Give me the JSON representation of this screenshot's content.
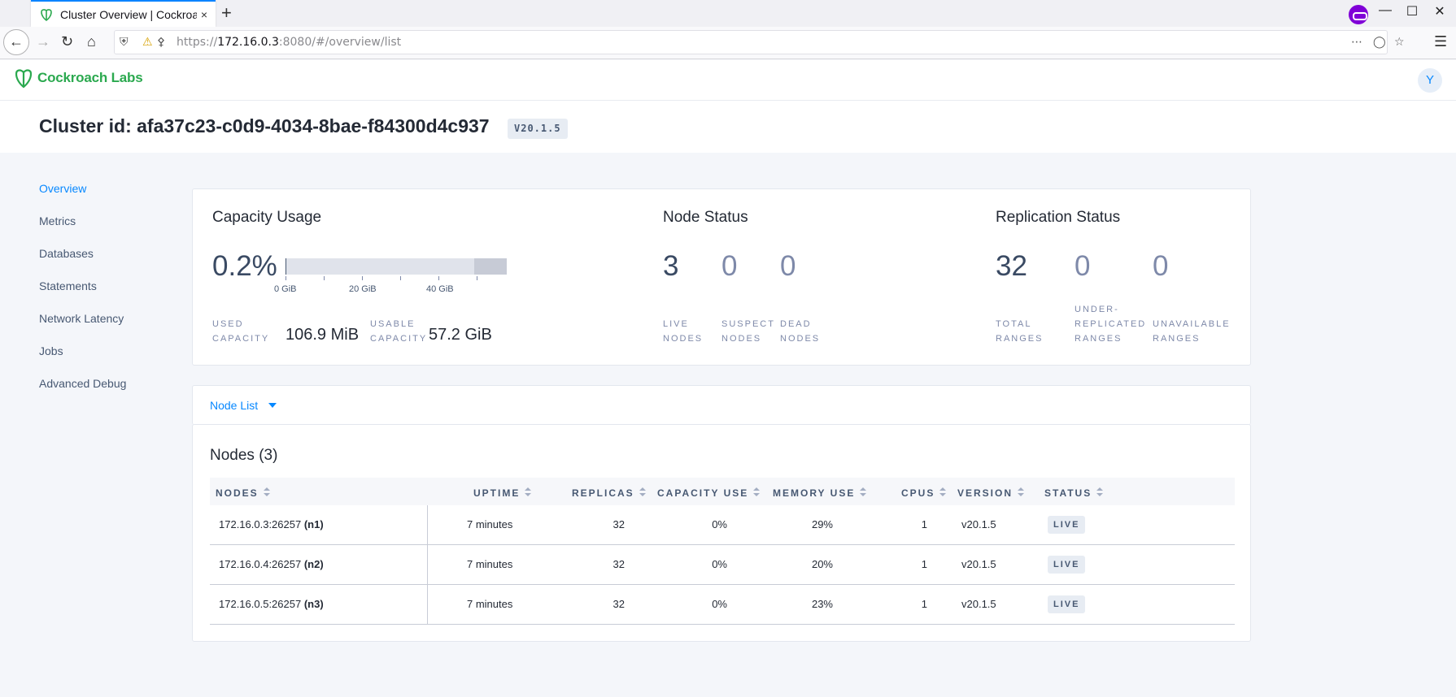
{
  "browser": {
    "tab_title": "Cluster Overview | Cockroach Labs",
    "tab_close": "×",
    "new_tab": "+",
    "url_prefix": "https://",
    "url_host": "172.16.0.3",
    "url_rest": ":8080/#/overview/list",
    "icons": [
      "back-arrow-icon",
      "forward-arrow-icon",
      "reload-icon",
      "home-icon",
      "shield-icon",
      "lock-warning-icon",
      "key-icon",
      "more-icon",
      "pocket-icon",
      "bookmark-star-icon",
      "hamburger-menu-icon",
      "private-browsing-icon"
    ]
  },
  "app": {
    "logo_text": "Cockroach Labs",
    "user_initial": "Y",
    "cluster_title": "Cluster id: afa37c23-c0d9-4034-8bae-f84300d4c937",
    "version": "V20.1.5",
    "accent_color": "#0788ff",
    "brand_color": "#2ba94f"
  },
  "sidebar": {
    "items": [
      {
        "label": "Overview",
        "active": true
      },
      {
        "label": "Metrics"
      },
      {
        "label": "Databases"
      },
      {
        "label": "Statements"
      },
      {
        "label": "Network Latency"
      },
      {
        "label": "Jobs"
      },
      {
        "label": "Advanced Debug"
      }
    ]
  },
  "capacity": {
    "title": "Capacity Usage",
    "percent": "0.2%",
    "used_fraction": 0.002,
    "axis_labels": [
      "0 GiB",
      "20 GiB",
      "40 GiB"
    ],
    "used_label_1": "USED",
    "used_label_2": "CAPACITY",
    "used_value": "106.9 MiB",
    "usable_label_1": "USABLE",
    "usable_label_2": "CAPACITY",
    "usable_value": "57.2 GiB"
  },
  "node_status": {
    "title": "Node Status",
    "live": "3",
    "suspect": "0",
    "dead": "0",
    "live_label_1": "LIVE",
    "live_label_2": "NODES",
    "suspect_label_1": "SUSPECT",
    "suspect_label_2": "NODES",
    "dead_label_1": "DEAD",
    "dead_label_2": "NODES"
  },
  "replication": {
    "title": "Replication Status",
    "total": "32",
    "under": "0",
    "unavailable": "0",
    "total_label_1": "TOTAL",
    "total_label_2": "RANGES",
    "under_label_1": "UNDER-",
    "under_label_2": "REPLICATED",
    "under_label_3": "RANGES",
    "unavail_label_1": "UNAVAILABLE",
    "unavail_label_2": "RANGES"
  },
  "node_list": {
    "dropdown_label": "Node List",
    "title": "Nodes (3)",
    "columns": [
      "NODES",
      "UPTIME",
      "REPLICAS",
      "CAPACITY USE",
      "MEMORY USE",
      "CPUS",
      "VERSION",
      "STATUS"
    ],
    "rows": [
      {
        "node": "172.16.0.3:26257",
        "id": "(n1)",
        "uptime": "7 minutes",
        "replicas": "32",
        "capacity": "0%",
        "memory": "29%",
        "cpus": "1",
        "version": "v20.1.5",
        "status": "LIVE"
      },
      {
        "node": "172.16.0.4:26257",
        "id": "(n2)",
        "uptime": "7 minutes",
        "replicas": "32",
        "capacity": "0%",
        "memory": "20%",
        "cpus": "1",
        "version": "v20.1.5",
        "status": "LIVE"
      },
      {
        "node": "172.16.0.5:26257",
        "id": "(n3)",
        "uptime": "7 minutes",
        "replicas": "32",
        "capacity": "0%",
        "memory": "23%",
        "cpus": "1",
        "version": "v20.1.5",
        "status": "LIVE"
      }
    ]
  }
}
